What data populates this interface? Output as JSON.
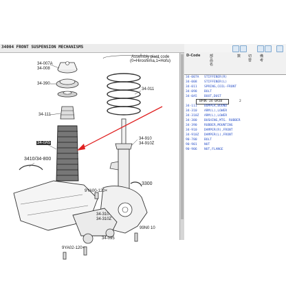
{
  "window": {
    "title": "34004  FRONT SUSPENSION MECHANISMS"
  },
  "diagram": {
    "labels": {
      "p34007a": "34-007A",
      "p34008": "34-008",
      "p34390": "34-390",
      "p34111": "34-111",
      "p340a5": "34-0A5",
      "p34011": "34-011",
      "p34910": "34-910",
      "p34910z": "34-910Z",
      "p34310_800": "3410/34-800",
      "p3300": "3300",
      "p9ya0": "9YA00-120×",
      "p34310": "34-310",
      "p34310z": "34-310Z",
      "p34095": "34-095",
      "p9yb0": "9YA02-120×",
      "p99nb": "99N0 10"
    },
    "note_line1": "Assembly plant code",
    "note_line2": "(0=Hiroshima,1=Hofu)"
  },
  "parts_table": {
    "header_code": "D-Code",
    "header_cols": [
      "部品名",
      "数",
      "切替",
      "備考"
    ],
    "rows": [
      {
        "code": "34-007A",
        "name": "STIFFENER(R)",
        "qty": "",
        "style": "blue"
      },
      {
        "code": "34-008",
        "name": "STIFFENER(L)",
        "qty": "",
        "style": "blue"
      },
      {
        "code": "34-011",
        "name": "SPRING,COIL-FRONT",
        "qty": "",
        "style": "blue"
      },
      {
        "code": "34-098",
        "name": "BOLT",
        "qty": "",
        "style": "blue"
      },
      {
        "code": "34-0A5",
        "name": "BOOT,DUST",
        "qty": "",
        "style": "blue"
      },
      {
        "code": "",
        "name": "BP4K-34-0A5B",
        "qty": "2",
        "style": "selected"
      },
      {
        "code": "34-111",
        "name": "BUMPER,BOUND",
        "qty": "",
        "style": "blue"
      },
      {
        "code": "34-310",
        "name": "ARM(L),LOWER",
        "qty": "",
        "style": "blue"
      },
      {
        "code": "34-310Z",
        "name": "ARM(L),LOWER",
        "qty": "",
        "style": "blue"
      },
      {
        "code": "34-380",
        "name": "BUSHING,MTG. RUBBER",
        "qty": "",
        "style": "blue"
      },
      {
        "code": "34-390",
        "name": "RUBBER,MOUNTING",
        "qty": "",
        "style": "blue"
      },
      {
        "code": "34-910",
        "name": "DAMPER(R),FRONT",
        "qty": "",
        "style": "blue"
      },
      {
        "code": "34-910Z",
        "name": "DAMPER(L),FRONT",
        "qty": "",
        "style": "blue"
      },
      {
        "code": "90-780",
        "name": "BOLT",
        "qty": "",
        "style": "blue"
      },
      {
        "code": "90-901",
        "name": "NUT",
        "qty": "",
        "style": "blue"
      },
      {
        "code": "90-906",
        "name": "NUT,FLANGE",
        "qty": "",
        "style": "blue"
      }
    ]
  },
  "colors": {
    "list_text": "#2a51c8",
    "arrow": "#e02020",
    "highlight": "#333333"
  }
}
